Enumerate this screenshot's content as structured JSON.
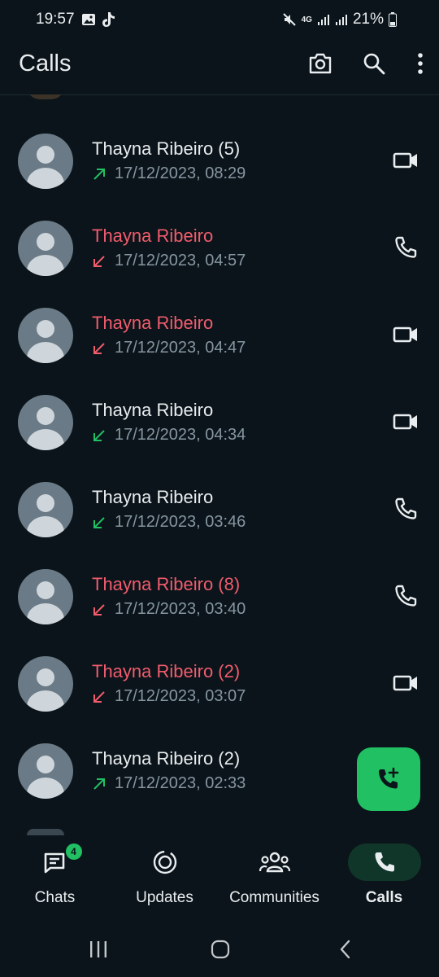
{
  "status_bar": {
    "time": "19:57",
    "network": "4G",
    "battery": "21%"
  },
  "header": {
    "title": "Calls",
    "actions": [
      "camera-icon",
      "search-icon",
      "more-vert-icon"
    ]
  },
  "colors": {
    "background": "#0b141a",
    "missed": "#f15c6d",
    "accent_green": "#21c063",
    "secondary_text": "#8696a0"
  },
  "calls": [
    {
      "name": "Thayna Ribeiro (5)",
      "time": "17/12/2023, 08:29",
      "direction": "outgoing",
      "missed": false,
      "call_type": "video"
    },
    {
      "name": "Thayna Ribeiro",
      "time": "17/12/2023, 04:57",
      "direction": "incoming",
      "missed": true,
      "call_type": "voice"
    },
    {
      "name": "Thayna Ribeiro",
      "time": "17/12/2023, 04:47",
      "direction": "incoming",
      "missed": true,
      "call_type": "video"
    },
    {
      "name": "Thayna Ribeiro",
      "time": "17/12/2023, 04:34",
      "direction": "incoming",
      "missed": false,
      "call_type": "video"
    },
    {
      "name": "Thayna Ribeiro",
      "time": "17/12/2023, 03:46",
      "direction": "incoming",
      "missed": false,
      "call_type": "voice"
    },
    {
      "name": "Thayna Ribeiro (8)",
      "time": "17/12/2023, 03:40",
      "direction": "incoming",
      "missed": true,
      "call_type": "voice"
    },
    {
      "name": "Thayna Ribeiro (2)",
      "time": "17/12/2023, 03:07",
      "direction": "incoming",
      "missed": true,
      "call_type": "video"
    },
    {
      "name": "Thayna Ribeiro (2)",
      "time": "17/12/2023, 02:33",
      "direction": "outgoing",
      "missed": false,
      "call_type": "none"
    }
  ],
  "fab": {
    "icon": "add-call-icon"
  },
  "bottom_nav": [
    {
      "label": "Chats",
      "icon": "chats-icon",
      "badge": "4",
      "active": false
    },
    {
      "label": "Updates",
      "icon": "updates-icon",
      "badge": "",
      "active": false
    },
    {
      "label": "Communities",
      "icon": "communities-icon",
      "badge": "",
      "active": false
    },
    {
      "label": "Calls",
      "icon": "calls-icon",
      "badge": "",
      "active": true
    }
  ],
  "system_nav": [
    "recents-button",
    "home-button",
    "back-button"
  ]
}
